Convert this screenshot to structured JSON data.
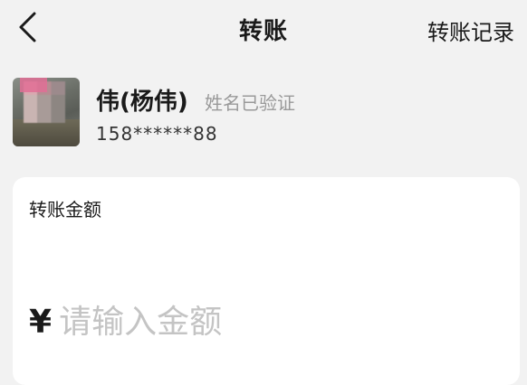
{
  "header": {
    "back_icon": "chevron-left-icon",
    "title": "转账",
    "records_link": "转账记录"
  },
  "recipient": {
    "name": "伟(杨伟)",
    "verified_text": "姓名已验证",
    "phone": "158******88"
  },
  "transfer_card": {
    "label": "转账金额",
    "currency_symbol": "¥",
    "amount_value": "",
    "amount_placeholder": "请输入金额"
  },
  "colors": {
    "page_background": "#f2f2f2",
    "card_background": "#ffffff",
    "muted_text": "#999999",
    "placeholder_text": "#c4c4c4"
  }
}
